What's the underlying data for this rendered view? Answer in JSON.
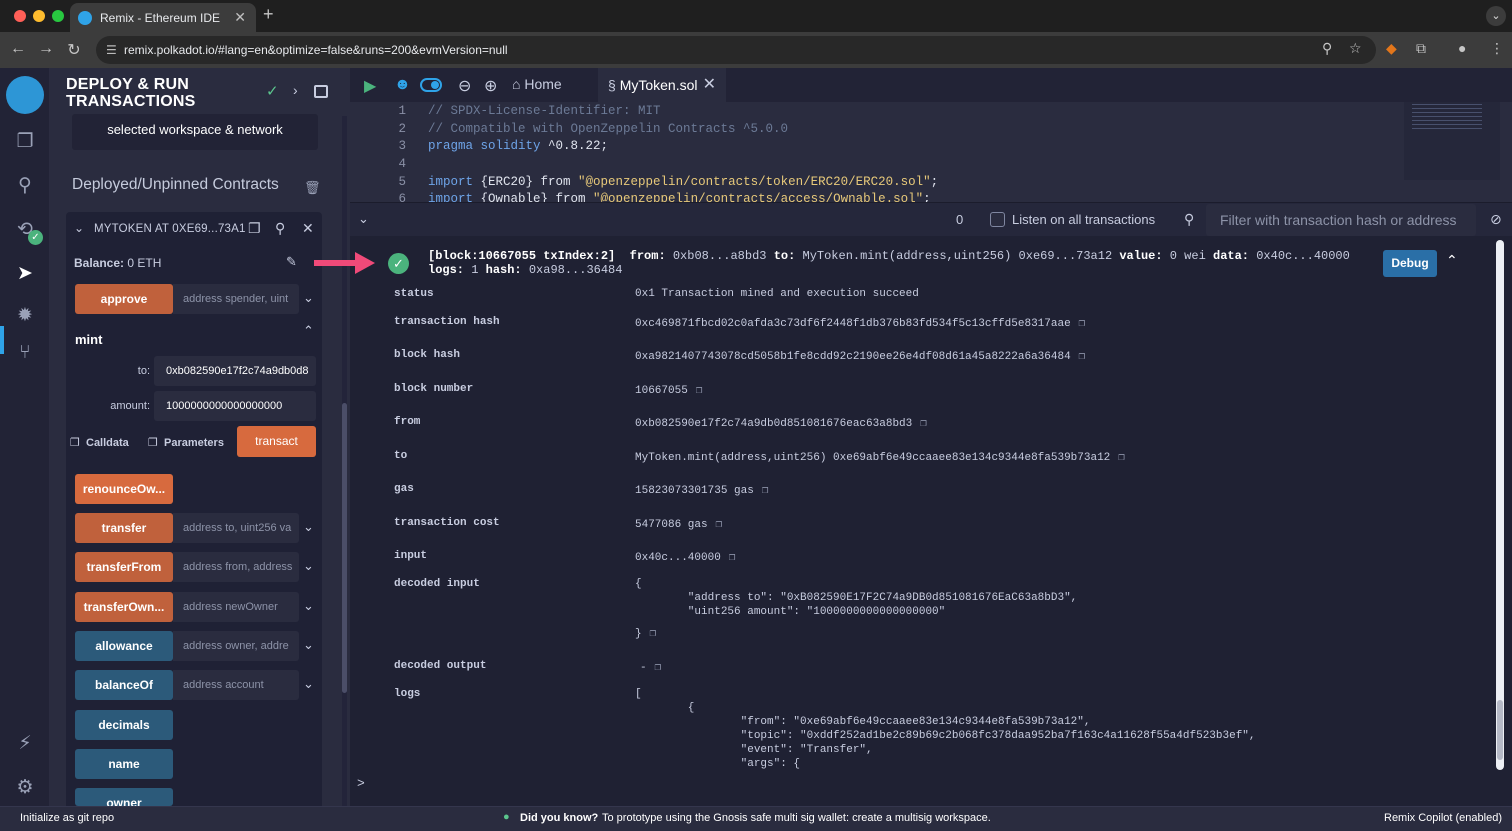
{
  "browser": {
    "tab_title": "Remix - Ethereum IDE",
    "url": "remix.polkadot.io/#lang=en&optimize=false&runs=200&evmVersion=null"
  },
  "side_panel": {
    "title": "DEPLOY & RUN TRANSACTIONS",
    "workspace_text": "selected workspace & network",
    "deployed_title": "Deployed/Unpinned Contracts",
    "instance_name": "MYTOKEN AT 0XE69...73A1",
    "balance_label": "Balance:",
    "balance_value": "0 ETH",
    "functions": [
      {
        "label": "approve",
        "placeholder": "address spender, uint"
      },
      {
        "label": "renounceOw..."
      },
      {
        "label": "transfer",
        "placeholder": "address to, uint256 va"
      },
      {
        "label": "transferFrom",
        "placeholder": "address from, address"
      },
      {
        "label": "transferOwn...",
        "placeholder": "address newOwner"
      },
      {
        "label": "allowance",
        "placeholder": "address owner, addre"
      },
      {
        "label": "balanceOf",
        "placeholder": "address account"
      },
      {
        "label": "decimals"
      },
      {
        "label": "name"
      },
      {
        "label": "owner"
      }
    ],
    "mint": {
      "label": "mint",
      "to_label": "to:",
      "to_value": "0xb082590e17f2c74a9db0d8",
      "amount_label": "amount:",
      "amount_value": "1000000000000000000",
      "calldata": "Calldata",
      "parameters": "Parameters",
      "transact": "transact"
    }
  },
  "editor": {
    "home_tab": "Home",
    "file_tab": "MyToken.sol",
    "lines": [
      {
        "n": "1",
        "text": "// SPDX-License-Identifier: MIT"
      },
      {
        "n": "2",
        "text": "// Compatible with OpenZeppelin Contracts ^5.0.0"
      },
      {
        "n": "3",
        "kw": "pragma solidity",
        "text": " ^0.8.22;"
      },
      {
        "n": "4",
        "text": ""
      },
      {
        "n": "5",
        "kw": "import",
        "text": " {ERC20} from ",
        "str": "\"@openzeppelin/contracts/token/ERC20/ERC20.sol\"",
        "end": ";"
      },
      {
        "n": "6",
        "kw": "import",
        "text": " {Ownable} from ",
        "str": "\"@openzeppelin/contracts/access/Ownable.sol\"",
        "end": ";"
      }
    ]
  },
  "terminal": {
    "count": "0",
    "listen_label": "Listen on all transactions",
    "filter_placeholder": "Filter with transaction hash or address",
    "tx_header_block": "[block:10667055 txIndex:2]",
    "tx_from_label": "from:",
    "tx_from": "0xb08...a8bd3",
    "tx_to_label": "to:",
    "tx_to": "MyToken.mint(address,uint256) 0xe69...73a12",
    "tx_value_label": "value:",
    "tx_value": "0 wei",
    "tx_data_label": "data:",
    "tx_data": "0x40c...40000",
    "tx_logs_label": "logs:",
    "tx_logs": "1",
    "tx_hash_label": "hash:",
    "tx_hash": "0xa98...36484",
    "debug": "Debug",
    "details": [
      {
        "key": "status",
        "value": "0x1 Transaction mined and execution succeed"
      },
      {
        "key": "transaction hash",
        "value": "0xc469871fbcd02c0afda3c73df6f2448f1db376b83fd534f5c13cffd5e8317aae"
      },
      {
        "key": "block hash",
        "value": "0xa9821407743078cd5058b1fe8cdd92c2190ee26e4df08d61a45a8222a6a36484"
      },
      {
        "key": "block number",
        "value": "10667055"
      },
      {
        "key": "from",
        "value": "0xb082590e17f2c74a9db0d851081676eac63a8bd3"
      },
      {
        "key": "to",
        "value": "MyToken.mint(address,uint256) 0xe69abf6e49ccaaee83e134c9344e8fa539b73a12"
      },
      {
        "key": "gas",
        "value": "15823073301735 gas"
      },
      {
        "key": "transaction cost",
        "value": "5477086 gas"
      },
      {
        "key": "input",
        "value": "0x40c...40000"
      },
      {
        "key": "decoded input",
        "value": "{"
      },
      {
        "key": "decoded output",
        "value": "-"
      },
      {
        "key": "logs",
        "value": "["
      }
    ],
    "decoded_input_lines": [
      "        \"address to\": \"0xB082590E17F2C74a9DB0d851081676EaC63a8bD3\",",
      "        \"uint256 amount\": \"1000000000000000000\"",
      "}"
    ],
    "logs_lines": [
      "        {",
      "                \"from\": \"0xe69abf6e49ccaaee83e134c9344e8fa539b73a12\",",
      "                \"topic\": \"0xddf252ad1be2c89b69c2b068fc378daa952ba7f163c4a11628f55a4df523b3ef\",",
      "                \"event\": \"Transfer\",",
      "                \"args\": {"
    ],
    "prompt": ">"
  },
  "statusbar": {
    "git": "Initialize as git repo",
    "did_you_know": "Did you know?",
    "tip": "To prototype using the Gnosis safe multi sig wallet: create a multisig workspace.",
    "copilot": "Remix Copilot (enabled)"
  }
}
